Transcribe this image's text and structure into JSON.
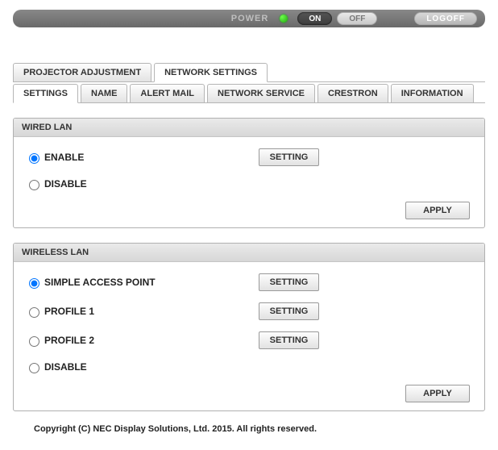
{
  "powerbar": {
    "power_label": "POWER",
    "on_label": "ON",
    "off_label": "OFF",
    "logoff_label": "LOGOFF"
  },
  "main_tabs": {
    "projector_adjustment": "PROJECTOR ADJUSTMENT",
    "network_settings": "NETWORK SETTINGS",
    "active": "network_settings"
  },
  "sub_tabs": {
    "settings": "SETTINGS",
    "name": "NAME",
    "alert_mail": "ALERT MAIL",
    "network_service": "NETWORK SERVICE",
    "crestron": "CRESTRON",
    "information": "INFORMATION",
    "active": "settings"
  },
  "wired_lan": {
    "title": "WIRED LAN",
    "options": {
      "enable": "ENABLE",
      "disable": "DISABLE",
      "selected": "enable"
    },
    "setting_button": "SETTING",
    "apply_button": "APPLY"
  },
  "wireless_lan": {
    "title": "WIRELESS LAN",
    "options": {
      "simple_ap": "SIMPLE ACCESS POINT",
      "profile1": "PROFILE 1",
      "profile2": "PROFILE 2",
      "disable": "DISABLE",
      "selected": "simple_ap"
    },
    "setting_button": "SETTING",
    "apply_button": "APPLY"
  },
  "copyright": "Copyright (C) NEC Display Solutions, Ltd. 2015. All rights reserved."
}
